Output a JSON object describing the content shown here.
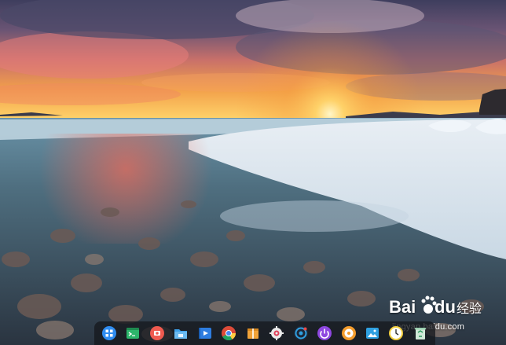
{
  "desktop": {
    "wallpaper": "winter-sunset-lake-with-ice",
    "dock": {
      "items": [
        {
          "name": "launcher",
          "icon": "launcher-icon",
          "color": "#2f8cf0"
        },
        {
          "name": "terminal",
          "icon": "terminal-icon",
          "color": "#2db56b"
        },
        {
          "name": "screen-recorder",
          "icon": "record-icon",
          "color": "#f05a4f"
        },
        {
          "name": "file-manager",
          "icon": "folder-icon",
          "color": "#3da0e8"
        },
        {
          "name": "movie-player",
          "icon": "movie-icon",
          "color": "#2e7de0"
        },
        {
          "name": "chrome",
          "icon": "chrome-icon",
          "color": "#dd4b39"
        },
        {
          "name": "archive-manager",
          "icon": "package-icon",
          "color": "#f1a33a"
        },
        {
          "name": "control-center",
          "icon": "gear-icon",
          "color": "#eaeaea"
        },
        {
          "name": "app-store",
          "icon": "store-icon",
          "color": "#2fa0e0"
        },
        {
          "name": "power",
          "icon": "power-icon",
          "color": "#8e47e0"
        },
        {
          "name": "music",
          "icon": "music-icon",
          "color": "#f39c2c"
        },
        {
          "name": "image-viewer",
          "icon": "image-icon",
          "color": "#2fa0e0"
        },
        {
          "name": "clock",
          "icon": "clock-icon",
          "color": "#f4d03f"
        },
        {
          "name": "trash",
          "icon": "trash-icon",
          "color": "#cfe8d7"
        }
      ]
    }
  },
  "watermark": {
    "logo_text": "Bai du 经验",
    "url": "jingyan.baidu.com"
  }
}
